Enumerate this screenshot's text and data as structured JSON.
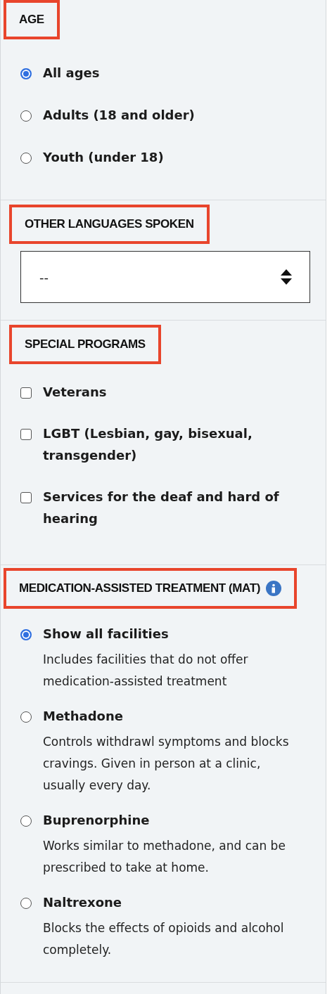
{
  "sections": [
    {
      "kind": "radio",
      "heading": "AGE",
      "highlighted": true,
      "options": [
        {
          "label": "All ages",
          "selected": true
        },
        {
          "label": "Adults (18 and older)",
          "selected": false
        },
        {
          "label": "Youth (under 18)",
          "selected": false
        }
      ]
    },
    {
      "kind": "select",
      "heading": "OTHER LANGUAGES SPOKEN",
      "highlighted": true,
      "value": "--"
    },
    {
      "kind": "checkbox",
      "heading": "SPECIAL PROGRAMS",
      "highlighted": true,
      "options": [
        {
          "label": "Veterans",
          "checked": false
        },
        {
          "label": "LGBT (Lesbian, gay, bisexual, transgender)",
          "checked": false
        },
        {
          "label": "Services for the deaf and hard of hearing",
          "checked": false
        }
      ]
    },
    {
      "kind": "radio",
      "heading": "MEDICATION-ASSISTED TREATMENT (MAT)",
      "highlighted": true,
      "info": true,
      "options": [
        {
          "label": "Show all facilities",
          "description": "Includes facilities that do not offer medication-assisted treatment",
          "selected": true
        },
        {
          "label": "Methadone",
          "description": "Controls withdrawl symptoms and blocks cravings. Given in person at a clinic, usually every day.",
          "selected": false
        },
        {
          "label": "Buprenorphine",
          "description": "Works similar to methadone, and can be prescribed to take at home.",
          "selected": false
        },
        {
          "label": "Naltrexone",
          "description": "Blocks the effects of opioids and alcohol completely.",
          "selected": false
        }
      ]
    }
  ]
}
